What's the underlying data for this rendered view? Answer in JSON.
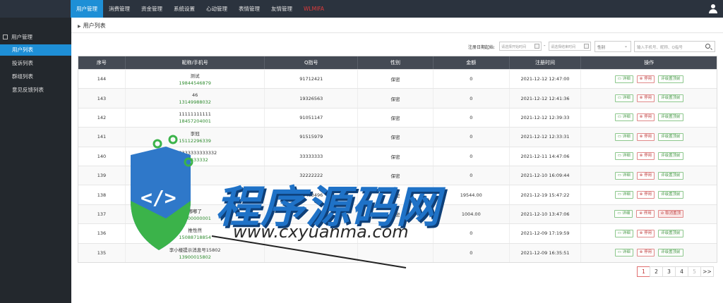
{
  "nav": {
    "items": [
      "用户管理",
      "消费管理",
      "资金管理",
      "系统设置",
      "心动管理",
      "表情管理",
      "友情管理",
      "WLMIFA"
    ]
  },
  "sidebar": {
    "header": "用户管理",
    "items": [
      "用户列表",
      "投诉列表",
      "群组列表",
      "意见反馈列表"
    ]
  },
  "breadcrumb": "用户列表",
  "filter": {
    "date_label": "注册日期起始:",
    "date_start_placeholder": "请选择开始时间",
    "date_end_placeholder": "请选择结束时间",
    "date_separator": "-",
    "select_value": "性别",
    "search_placeholder": "输入手机号、昵称、Q指号"
  },
  "table": {
    "headers": [
      "序号",
      "昵称/手机号",
      "Q指号",
      "性别",
      "金额",
      "注册时间",
      "操作"
    ],
    "rows": [
      {
        "id": "144",
        "nick": "测试",
        "phone": "19844546879",
        "qid": "91712421",
        "gender": "保密",
        "amount": "0",
        "time": "2021-12-12 12:47:00",
        "op3": "评级置顶前"
      },
      {
        "id": "143",
        "nick": "46",
        "phone": "13149988032",
        "qid": "19326563",
        "gender": "保密",
        "amount": "0",
        "time": "2021-12-12 12:41:36",
        "op3": "评级置顶前"
      },
      {
        "id": "142",
        "nick": "11111111111",
        "phone": "18457204001",
        "qid": "91051147",
        "gender": "保密",
        "amount": "0",
        "time": "2021-12-12 12:39:33",
        "op3": "评级置顶前"
      },
      {
        "id": "141",
        "nick": "李冠",
        "phone": "15112296339",
        "qid": "91515979",
        "gender": "保密",
        "amount": "0",
        "time": "2021-12-12 12:33:31",
        "op3": "评级置顶前"
      },
      {
        "id": "140",
        "nick": "333333333333332",
        "phone": "333333332",
        "qid": "33333333",
        "gender": "保密",
        "amount": "0",
        "time": "2021-12-11 14:47:06",
        "op3": "评级置顶前"
      },
      {
        "id": "139",
        "nick": "",
        "phone": "",
        "qid": "32222222",
        "gender": "保密",
        "amount": "0",
        "time": "2021-12-10 16:09:44",
        "op3": "评级置顶前"
      },
      {
        "id": "138",
        "nick": "",
        "phone": "",
        "qid": "41483496",
        "gender": "保密",
        "amount": "19544.00",
        "time": "2021-12-19 15:47:22",
        "op3": "评级置顶前"
      },
      {
        "id": "137",
        "nick": "嘟嘟了",
        "phone": "17000000001",
        "qid": "",
        "gender": "保密",
        "amount": "1004.00",
        "time": "2021-12-10 13:47:06",
        "op3": "取消置顶"
      },
      {
        "id": "136",
        "nick": "推性然",
        "phone": "15088718854",
        "qid": "",
        "gender": "",
        "amount": "0",
        "time": "2021-12-09 17:19:59",
        "op3": "评级置顶前"
      },
      {
        "id": "135",
        "nick": "李小楼提示消息号15802",
        "phone": "13900015802",
        "qid": "",
        "gender": "",
        "amount": "0",
        "time": "2021-12-09 16:35:51",
        "op3": "评级置顶前"
      }
    ],
    "op_detail": "详细",
    "op_disable": "停用"
  },
  "pager": {
    "pages": [
      "1",
      "2",
      "3",
      "4",
      "5",
      ">>"
    ],
    "current": "1"
  },
  "watermark": {
    "text": "程序源码网",
    "url": "www.cxyuanma.com"
  }
}
